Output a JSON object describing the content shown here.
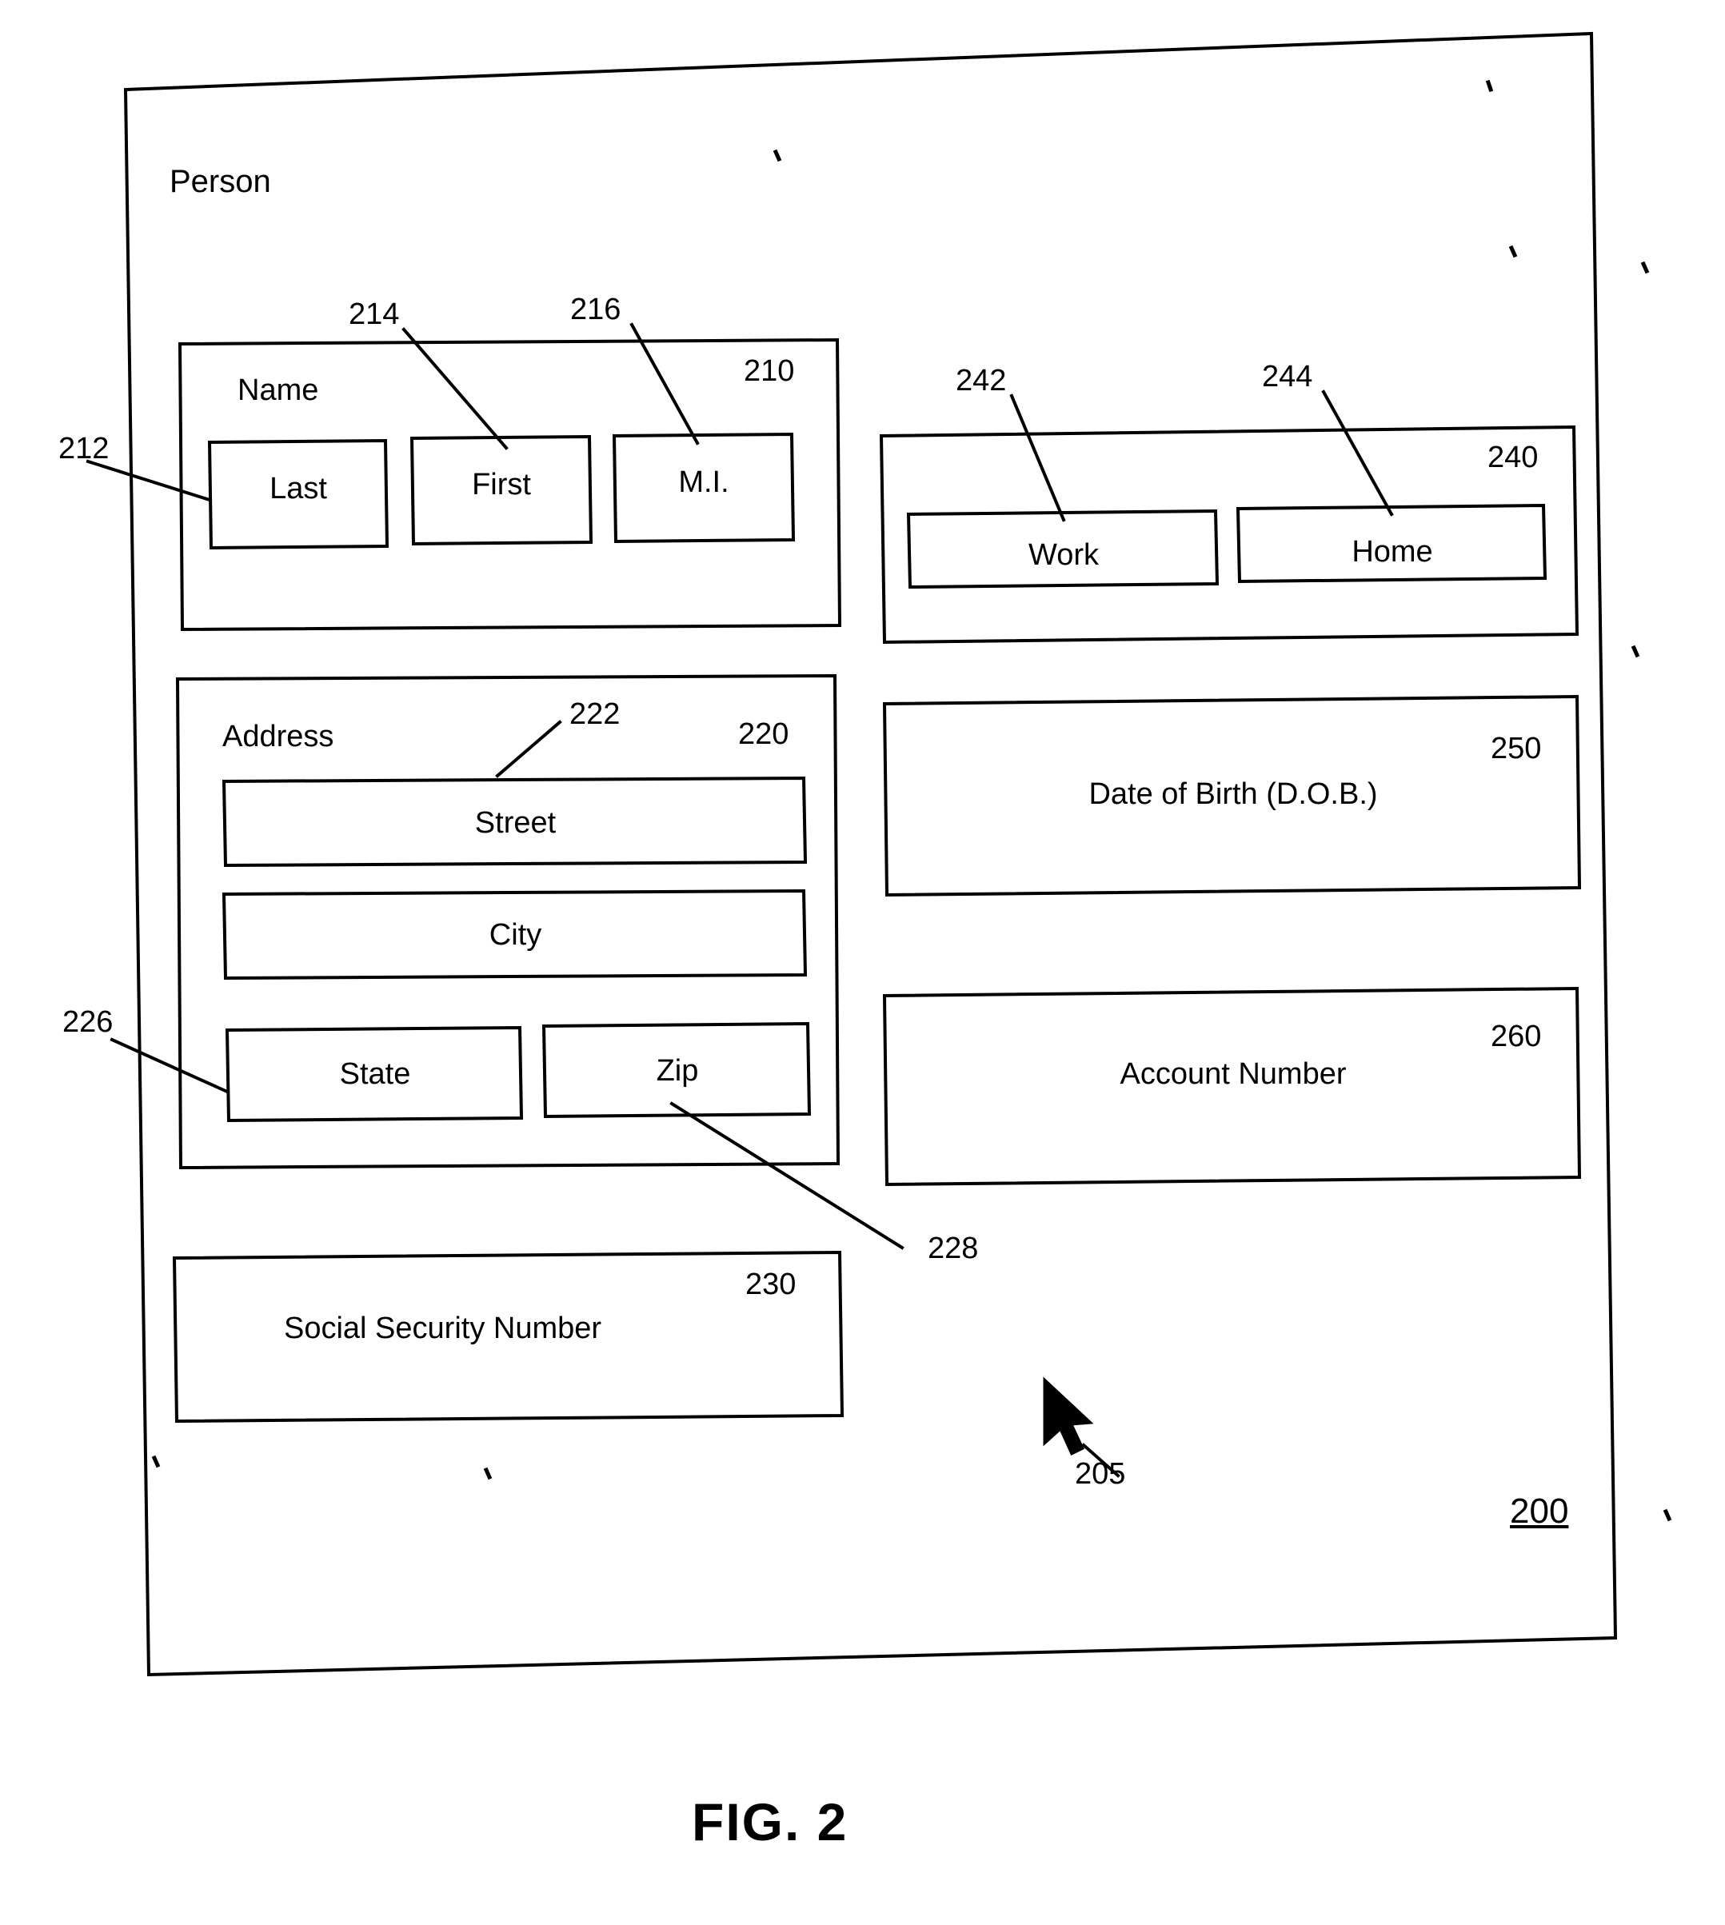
{
  "figure": {
    "caption": "FIG. 2",
    "diagram_ref": "200",
    "panel_title": "Person",
    "cursor_ref": "205"
  },
  "groups": {
    "name": {
      "title": "Name",
      "ref": "210",
      "fields": [
        {
          "label": "Last",
          "ref": "212"
        },
        {
          "label": "First",
          "ref": "214"
        },
        {
          "label": "M.I.",
          "ref": "216"
        }
      ]
    },
    "address": {
      "title": "Address",
      "ref": "220",
      "fields": [
        {
          "label": "Street",
          "ref": "222"
        },
        {
          "label": "City",
          "ref": ""
        },
        {
          "label": "State",
          "ref": "226"
        },
        {
          "label": "Zip",
          "ref": "228"
        }
      ]
    },
    "phone": {
      "title": "",
      "ref": "240",
      "fields": [
        {
          "label": "Work",
          "ref": "242"
        },
        {
          "label": "Home",
          "ref": "244"
        }
      ]
    }
  },
  "standalone_fields": [
    {
      "label": "Social Security Number",
      "ref": "230"
    },
    {
      "label": "Date of Birth (D.O.B.)",
      "ref": "250"
    },
    {
      "label": "Account Number",
      "ref": "260"
    }
  ]
}
